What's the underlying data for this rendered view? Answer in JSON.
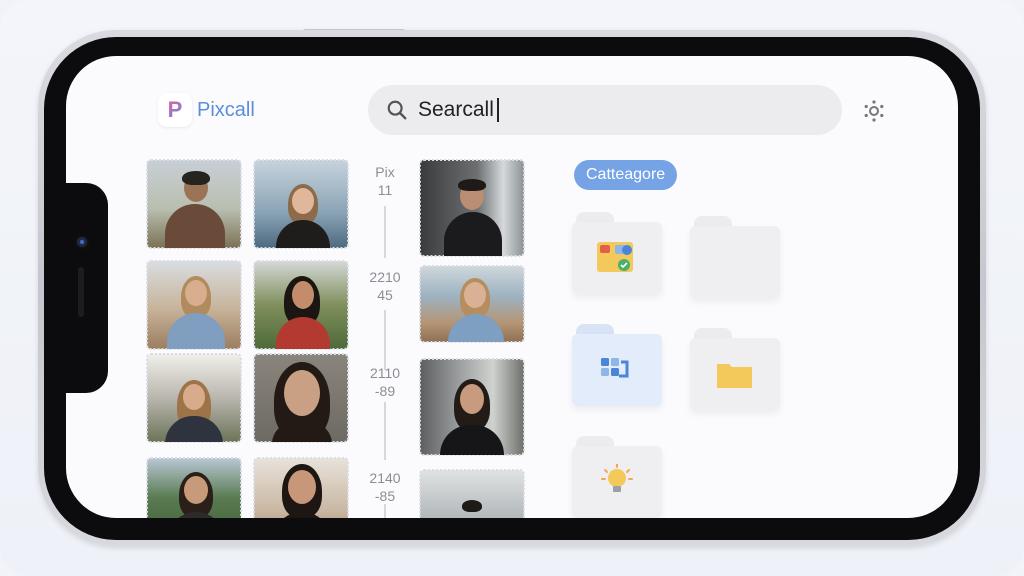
{
  "app": {
    "logo_letter": "P",
    "name": "Pixcall"
  },
  "search": {
    "value": "Searcall",
    "placeholder": ""
  },
  "category_chip": "Catteagore",
  "timeline": [
    {
      "line1": "Pix",
      "line2": "11"
    },
    {
      "line1": "2210",
      "line2": "45"
    },
    {
      "line1": "2110",
      "line2": "-89"
    },
    {
      "line1": "2140",
      "line2": "-85"
    }
  ],
  "photos_left": [
    [
      "portrait-man-beanie",
      "portrait-woman-lake"
    ],
    [
      "portrait-woman-field",
      "portrait-woman-grass"
    ],
    [
      "portrait-woman-building",
      "portrait-woman-closeup"
    ],
    [
      "portrait-woman-mountain",
      "portrait-woman-outdoor"
    ]
  ],
  "photos_right": [
    "portrait-man-window",
    "portrait-woman-beach",
    "portrait-woman-room",
    "portrait-man-partial"
  ],
  "folders": [
    {
      "name": "folder-photos",
      "icon": "photo-collage-icon"
    },
    {
      "name": "folder-empty",
      "icon": ""
    },
    {
      "name": "folder-blue-apps",
      "icon": "puzzle-icon"
    },
    {
      "name": "folder-yellow",
      "icon": "folder-icon"
    },
    {
      "name": "folder-ideas",
      "icon": "lightbulb-icon"
    }
  ],
  "colors": {
    "accent": "#5b8ed8",
    "chip": "#76a3e6",
    "frame": "#0c0c0e"
  }
}
